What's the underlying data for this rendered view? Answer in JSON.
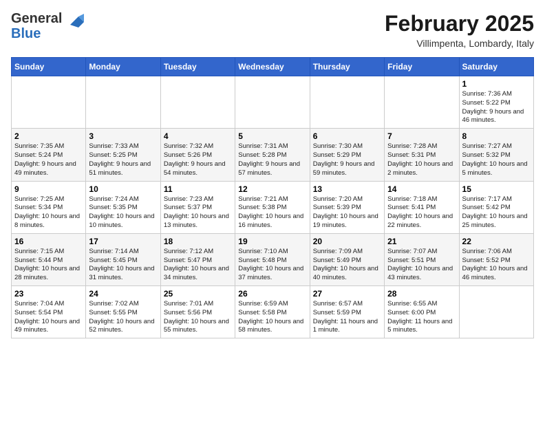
{
  "app": {
    "logo_line1": "General",
    "logo_line2": "Blue"
  },
  "header": {
    "month": "February 2025",
    "location": "Villimpenta, Lombardy, Italy"
  },
  "days_of_week": [
    "Sunday",
    "Monday",
    "Tuesday",
    "Wednesday",
    "Thursday",
    "Friday",
    "Saturday"
  ],
  "weeks": [
    [
      {
        "day": "",
        "info": ""
      },
      {
        "day": "",
        "info": ""
      },
      {
        "day": "",
        "info": ""
      },
      {
        "day": "",
        "info": ""
      },
      {
        "day": "",
        "info": ""
      },
      {
        "day": "",
        "info": ""
      },
      {
        "day": "1",
        "info": "Sunrise: 7:36 AM\nSunset: 5:22 PM\nDaylight: 9 hours and 46 minutes."
      }
    ],
    [
      {
        "day": "2",
        "info": "Sunrise: 7:35 AM\nSunset: 5:24 PM\nDaylight: 9 hours and 49 minutes."
      },
      {
        "day": "3",
        "info": "Sunrise: 7:33 AM\nSunset: 5:25 PM\nDaylight: 9 hours and 51 minutes."
      },
      {
        "day": "4",
        "info": "Sunrise: 7:32 AM\nSunset: 5:26 PM\nDaylight: 9 hours and 54 minutes."
      },
      {
        "day": "5",
        "info": "Sunrise: 7:31 AM\nSunset: 5:28 PM\nDaylight: 9 hours and 57 minutes."
      },
      {
        "day": "6",
        "info": "Sunrise: 7:30 AM\nSunset: 5:29 PM\nDaylight: 9 hours and 59 minutes."
      },
      {
        "day": "7",
        "info": "Sunrise: 7:28 AM\nSunset: 5:31 PM\nDaylight: 10 hours and 2 minutes."
      },
      {
        "day": "8",
        "info": "Sunrise: 7:27 AM\nSunset: 5:32 PM\nDaylight: 10 hours and 5 minutes."
      }
    ],
    [
      {
        "day": "9",
        "info": "Sunrise: 7:25 AM\nSunset: 5:34 PM\nDaylight: 10 hours and 8 minutes."
      },
      {
        "day": "10",
        "info": "Sunrise: 7:24 AM\nSunset: 5:35 PM\nDaylight: 10 hours and 10 minutes."
      },
      {
        "day": "11",
        "info": "Sunrise: 7:23 AM\nSunset: 5:37 PM\nDaylight: 10 hours and 13 minutes."
      },
      {
        "day": "12",
        "info": "Sunrise: 7:21 AM\nSunset: 5:38 PM\nDaylight: 10 hours and 16 minutes."
      },
      {
        "day": "13",
        "info": "Sunrise: 7:20 AM\nSunset: 5:39 PM\nDaylight: 10 hours and 19 minutes."
      },
      {
        "day": "14",
        "info": "Sunrise: 7:18 AM\nSunset: 5:41 PM\nDaylight: 10 hours and 22 minutes."
      },
      {
        "day": "15",
        "info": "Sunrise: 7:17 AM\nSunset: 5:42 PM\nDaylight: 10 hours and 25 minutes."
      }
    ],
    [
      {
        "day": "16",
        "info": "Sunrise: 7:15 AM\nSunset: 5:44 PM\nDaylight: 10 hours and 28 minutes."
      },
      {
        "day": "17",
        "info": "Sunrise: 7:14 AM\nSunset: 5:45 PM\nDaylight: 10 hours and 31 minutes."
      },
      {
        "day": "18",
        "info": "Sunrise: 7:12 AM\nSunset: 5:47 PM\nDaylight: 10 hours and 34 minutes."
      },
      {
        "day": "19",
        "info": "Sunrise: 7:10 AM\nSunset: 5:48 PM\nDaylight: 10 hours and 37 minutes."
      },
      {
        "day": "20",
        "info": "Sunrise: 7:09 AM\nSunset: 5:49 PM\nDaylight: 10 hours and 40 minutes."
      },
      {
        "day": "21",
        "info": "Sunrise: 7:07 AM\nSunset: 5:51 PM\nDaylight: 10 hours and 43 minutes."
      },
      {
        "day": "22",
        "info": "Sunrise: 7:06 AM\nSunset: 5:52 PM\nDaylight: 10 hours and 46 minutes."
      }
    ],
    [
      {
        "day": "23",
        "info": "Sunrise: 7:04 AM\nSunset: 5:54 PM\nDaylight: 10 hours and 49 minutes."
      },
      {
        "day": "24",
        "info": "Sunrise: 7:02 AM\nSunset: 5:55 PM\nDaylight: 10 hours and 52 minutes."
      },
      {
        "day": "25",
        "info": "Sunrise: 7:01 AM\nSunset: 5:56 PM\nDaylight: 10 hours and 55 minutes."
      },
      {
        "day": "26",
        "info": "Sunrise: 6:59 AM\nSunset: 5:58 PM\nDaylight: 10 hours and 58 minutes."
      },
      {
        "day": "27",
        "info": "Sunrise: 6:57 AM\nSunset: 5:59 PM\nDaylight: 11 hours and 1 minute."
      },
      {
        "day": "28",
        "info": "Sunrise: 6:55 AM\nSunset: 6:00 PM\nDaylight: 11 hours and 5 minutes."
      },
      {
        "day": "",
        "info": ""
      }
    ]
  ]
}
